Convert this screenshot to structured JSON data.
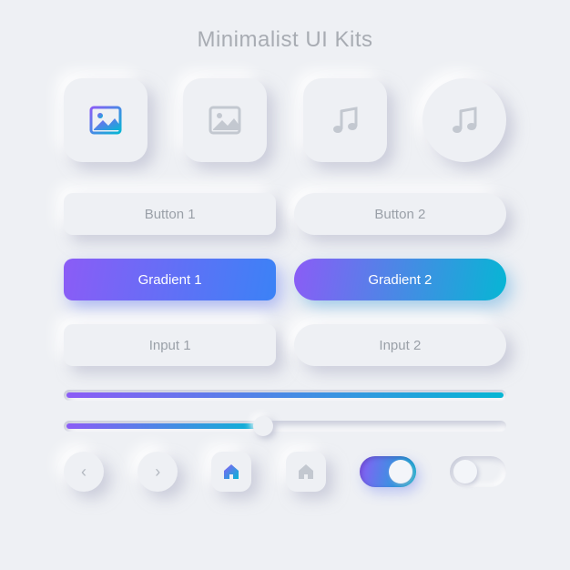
{
  "title": "Minimalist UI Kits",
  "colors": {
    "gradient_start": "#8b5cf6",
    "gradient_end_blue": "#3b82f6",
    "gradient_end_cyan": "#06b6d4",
    "background": "#eef0f4",
    "text_muted": "#9aa0a8"
  },
  "icon_tiles": [
    {
      "icon": "image-icon",
      "shape": "rounded-square",
      "style": "gradient"
    },
    {
      "icon": "image-icon",
      "shape": "rounded-square",
      "style": "muted"
    },
    {
      "icon": "music-icon",
      "shape": "rounded-square",
      "style": "muted"
    },
    {
      "icon": "music-icon",
      "shape": "circle",
      "style": "muted"
    }
  ],
  "buttons": {
    "plain": {
      "left": "Button 1",
      "right": "Button 2"
    },
    "gradient": {
      "left": "Gradient 1",
      "right": "Gradient 2"
    },
    "input": {
      "left": "Input 1",
      "right": "Input 2"
    }
  },
  "sliders": [
    {
      "value": 100
    },
    {
      "value": 45
    }
  ],
  "bottom": {
    "prev": "‹",
    "next": "›",
    "home1": {
      "icon": "home-icon",
      "style": "gradient"
    },
    "home2": {
      "icon": "home-icon",
      "style": "muted"
    },
    "toggle_on": true,
    "toggle_off": false
  }
}
